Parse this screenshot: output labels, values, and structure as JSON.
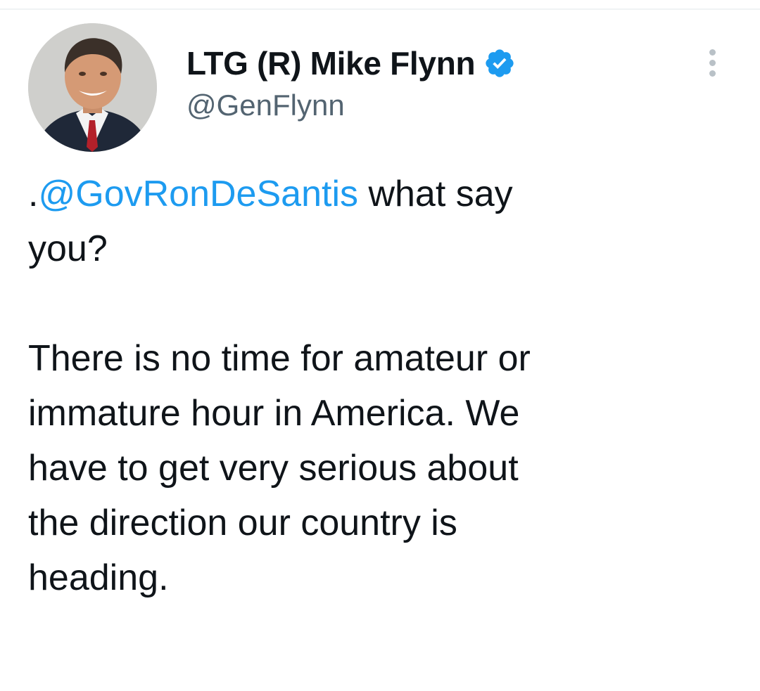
{
  "author": {
    "display_name": "LTG (R) Mike Flynn",
    "handle": "@GenFlynn",
    "verified": true
  },
  "tweet": {
    "mention_prefix": ".",
    "mention": "@GovRonDeSantis",
    "line1_rest": " what say",
    "line2": "you?",
    "paragraph2_lines": [
      "There is no time for amateur or",
      "immature hour in America. We",
      "have to get very serious about",
      "the direction our country is",
      "heading."
    ]
  },
  "icons": {
    "verified": "verified-badge-icon",
    "more": "more-options-icon"
  },
  "colors": {
    "text": "#0f1419",
    "secondary": "#536471",
    "link": "#1d9bf0",
    "verified": "#1d9bf0",
    "divider": "#eff3f4"
  }
}
